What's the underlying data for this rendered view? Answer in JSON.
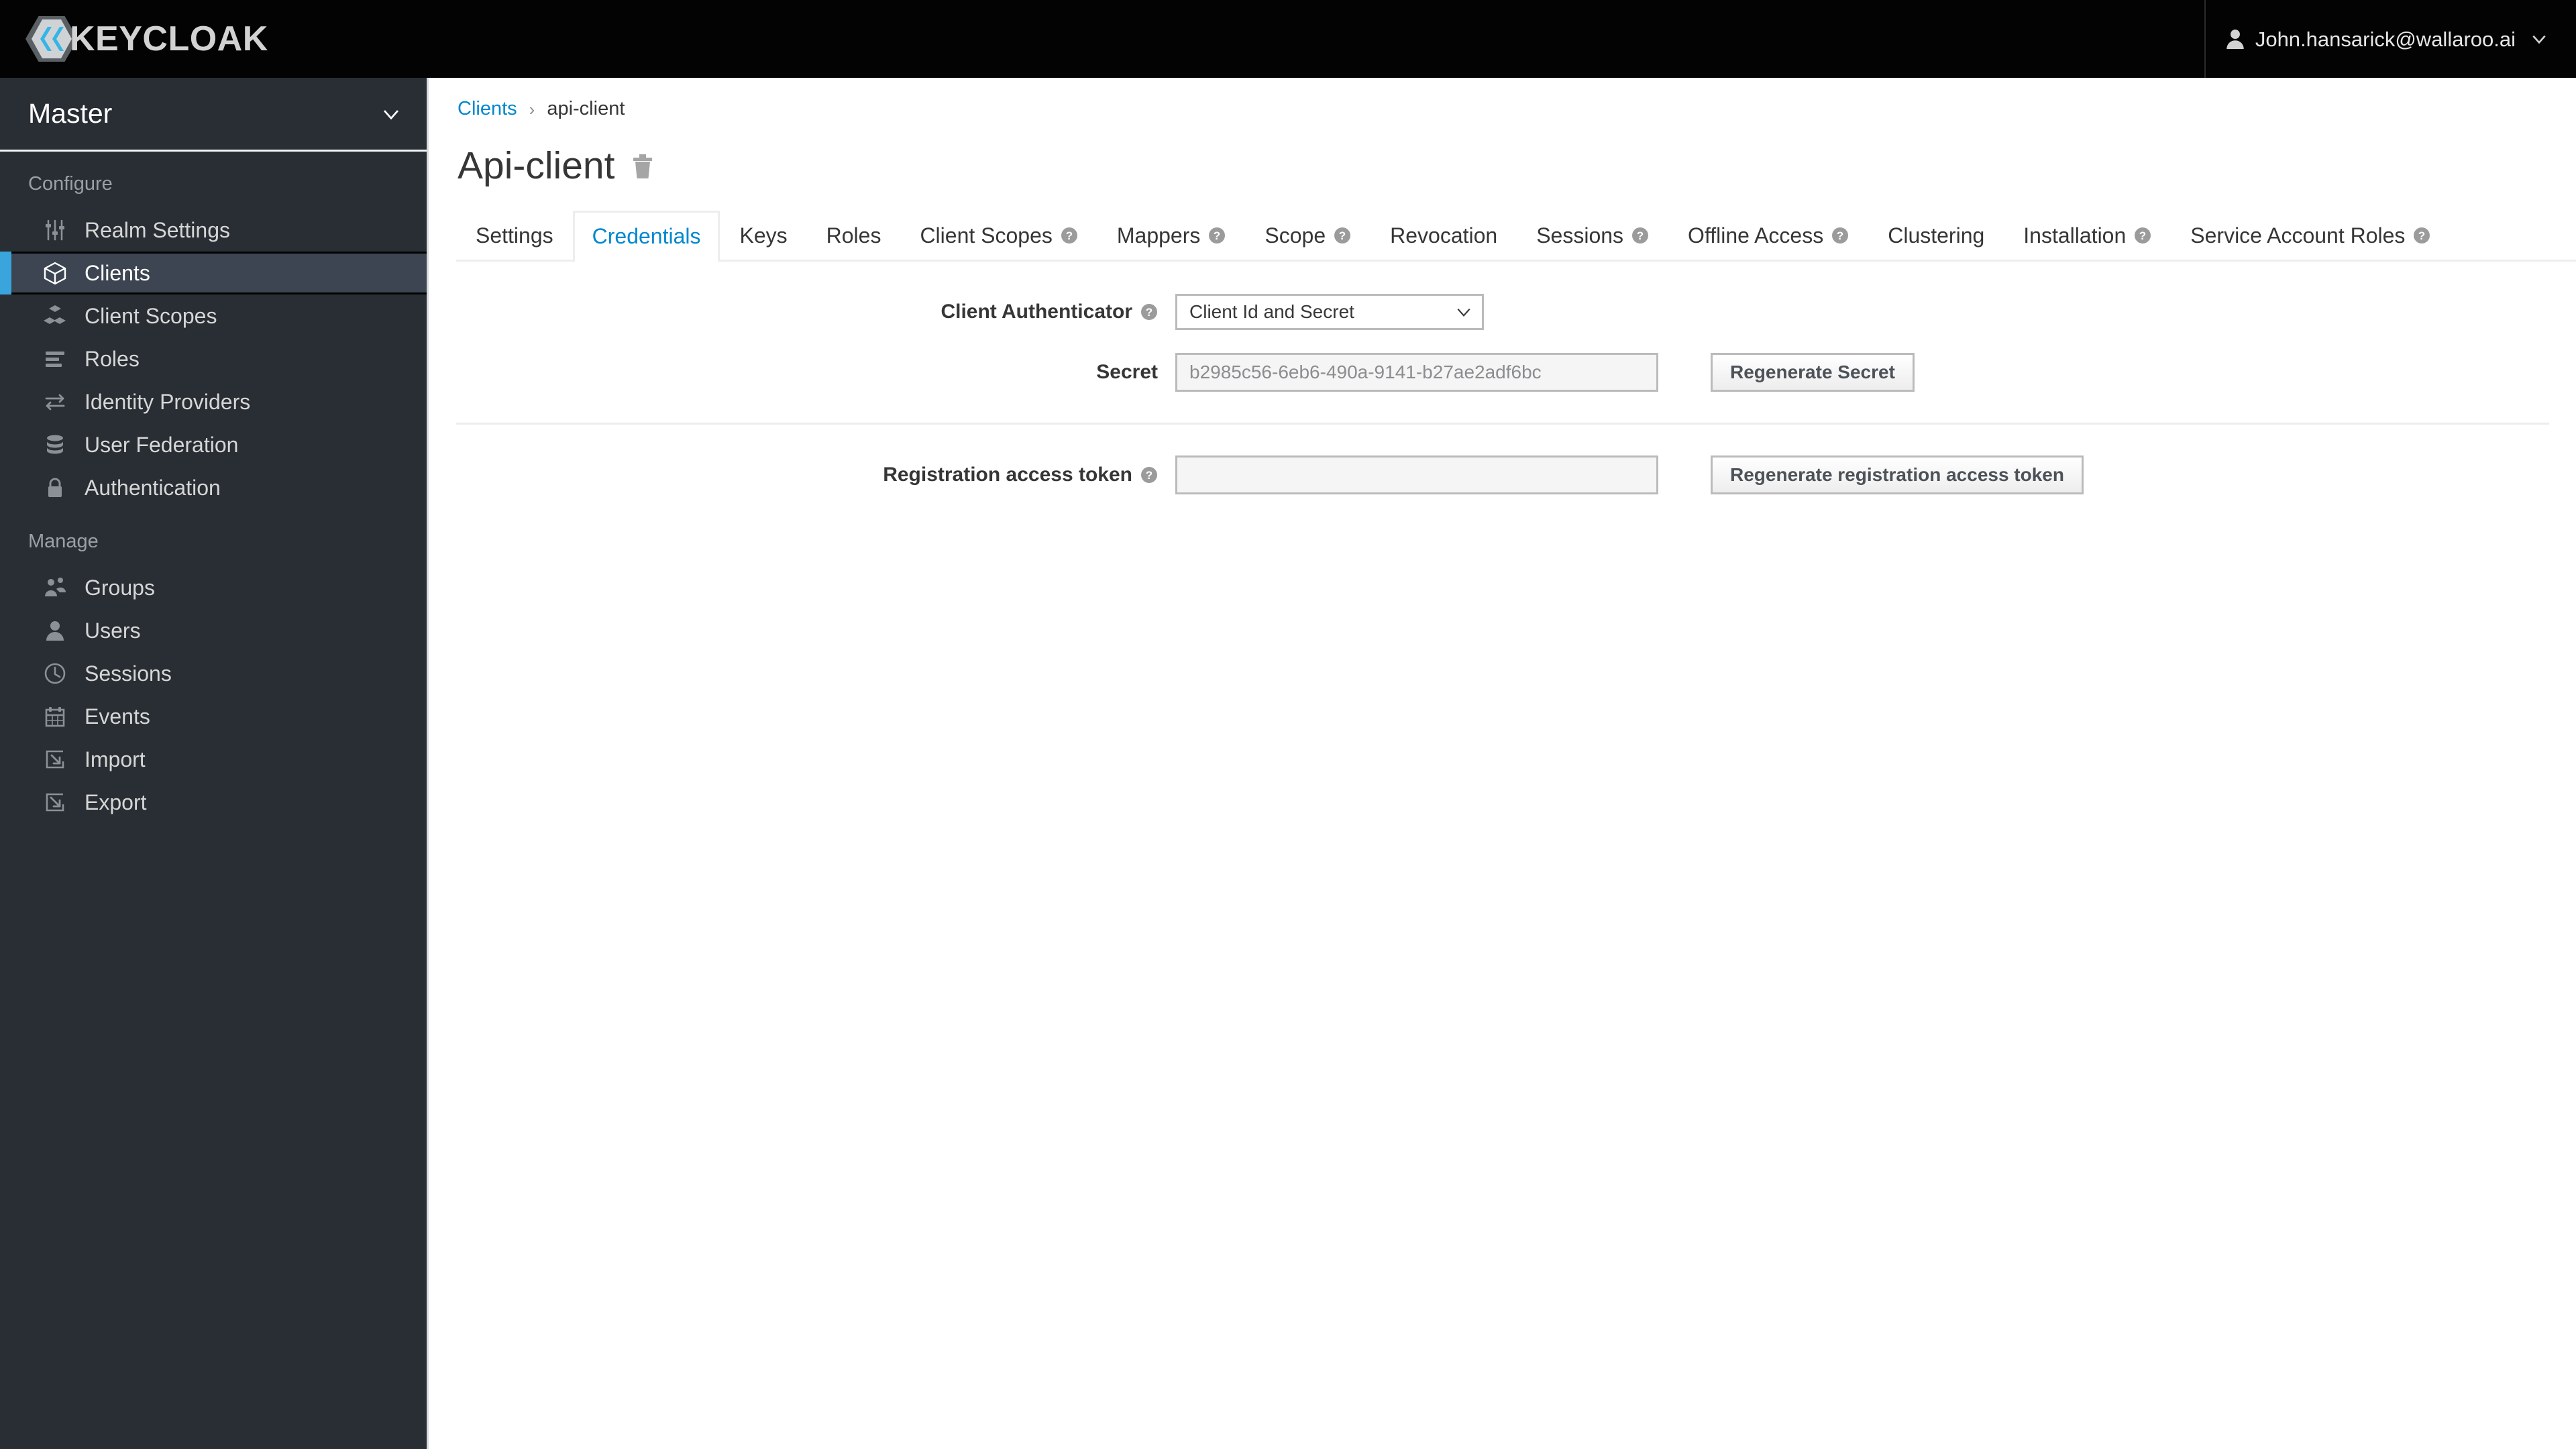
{
  "masthead": {
    "brand_name": "KEYCLOAK",
    "brand_icon": "keycloak-logo",
    "user_icon": "user-avatar-icon",
    "user_name": "John.hansarick@wallaroo.ai",
    "caret_icon": "chevron-down-icon"
  },
  "sidebar": {
    "realm": {
      "name": "Master",
      "caret_icon": "chevron-down-icon"
    },
    "sections": [
      {
        "title": "Configure",
        "items": [
          {
            "label": "Realm Settings",
            "icon": "sliders-icon",
            "active": false
          },
          {
            "label": "Clients",
            "icon": "cube-icon",
            "active": true
          },
          {
            "label": "Client Scopes",
            "icon": "cubes-icon",
            "active": false
          },
          {
            "label": "Roles",
            "icon": "list-icon",
            "active": false
          },
          {
            "label": "Identity Providers",
            "icon": "exchange-arrows-icon",
            "active": false
          },
          {
            "label": "User Federation",
            "icon": "database-icon",
            "active": false
          },
          {
            "label": "Authentication",
            "icon": "lock-icon",
            "active": false
          }
        ]
      },
      {
        "title": "Manage",
        "items": [
          {
            "label": "Groups",
            "icon": "users-group-icon",
            "active": false
          },
          {
            "label": "Users",
            "icon": "user-icon",
            "active": false
          },
          {
            "label": "Sessions",
            "icon": "clock-icon",
            "active": false
          },
          {
            "label": "Events",
            "icon": "calendar-icon",
            "active": false
          },
          {
            "label": "Import",
            "icon": "import-arrow-icon",
            "active": false
          },
          {
            "label": "Export",
            "icon": "export-arrow-icon",
            "active": false
          }
        ]
      }
    ]
  },
  "breadcrumb": {
    "parent": "Clients",
    "separator": "›",
    "current": "api-client"
  },
  "page": {
    "title": "Api-client",
    "delete_icon": "trash-icon"
  },
  "tabs": [
    {
      "label": "Settings",
      "help": false,
      "active": false
    },
    {
      "label": "Credentials",
      "help": false,
      "active": true
    },
    {
      "label": "Keys",
      "help": false,
      "active": false
    },
    {
      "label": "Roles",
      "help": false,
      "active": false
    },
    {
      "label": "Client Scopes",
      "help": true,
      "active": false
    },
    {
      "label": "Mappers",
      "help": true,
      "active": false
    },
    {
      "label": "Scope",
      "help": true,
      "active": false
    },
    {
      "label": "Revocation",
      "help": false,
      "active": false
    },
    {
      "label": "Sessions",
      "help": true,
      "active": false
    },
    {
      "label": "Offline Access",
      "help": true,
      "active": false
    },
    {
      "label": "Clustering",
      "help": false,
      "active": false
    },
    {
      "label": "Installation",
      "help": true,
      "active": false
    },
    {
      "label": "Service Account Roles",
      "help": true,
      "active": false
    }
  ],
  "form": {
    "client_authenticator": {
      "label": "Client Authenticator",
      "help_icon": "help-circle-icon",
      "value": "Client Id and Secret",
      "caret_icon": "chevron-down-icon",
      "options": [
        "Client Id and Secret"
      ]
    },
    "secret": {
      "label": "Secret",
      "value": "b2985c56-6eb6-490a-9141-b27ae2adf6bc",
      "button_label": "Regenerate Secret"
    },
    "registration_access_token": {
      "label": "Registration access token",
      "help_icon": "help-circle-icon",
      "value": "",
      "button_label": "Regenerate registration access token"
    }
  },
  "colors": {
    "accent_blue": "#0088ce",
    "sidebar_bg": "#292e34",
    "sidebar_active_bg": "#3c4551",
    "sidebar_active_bar": "#39a5dc",
    "masthead_bg": "#030303"
  }
}
